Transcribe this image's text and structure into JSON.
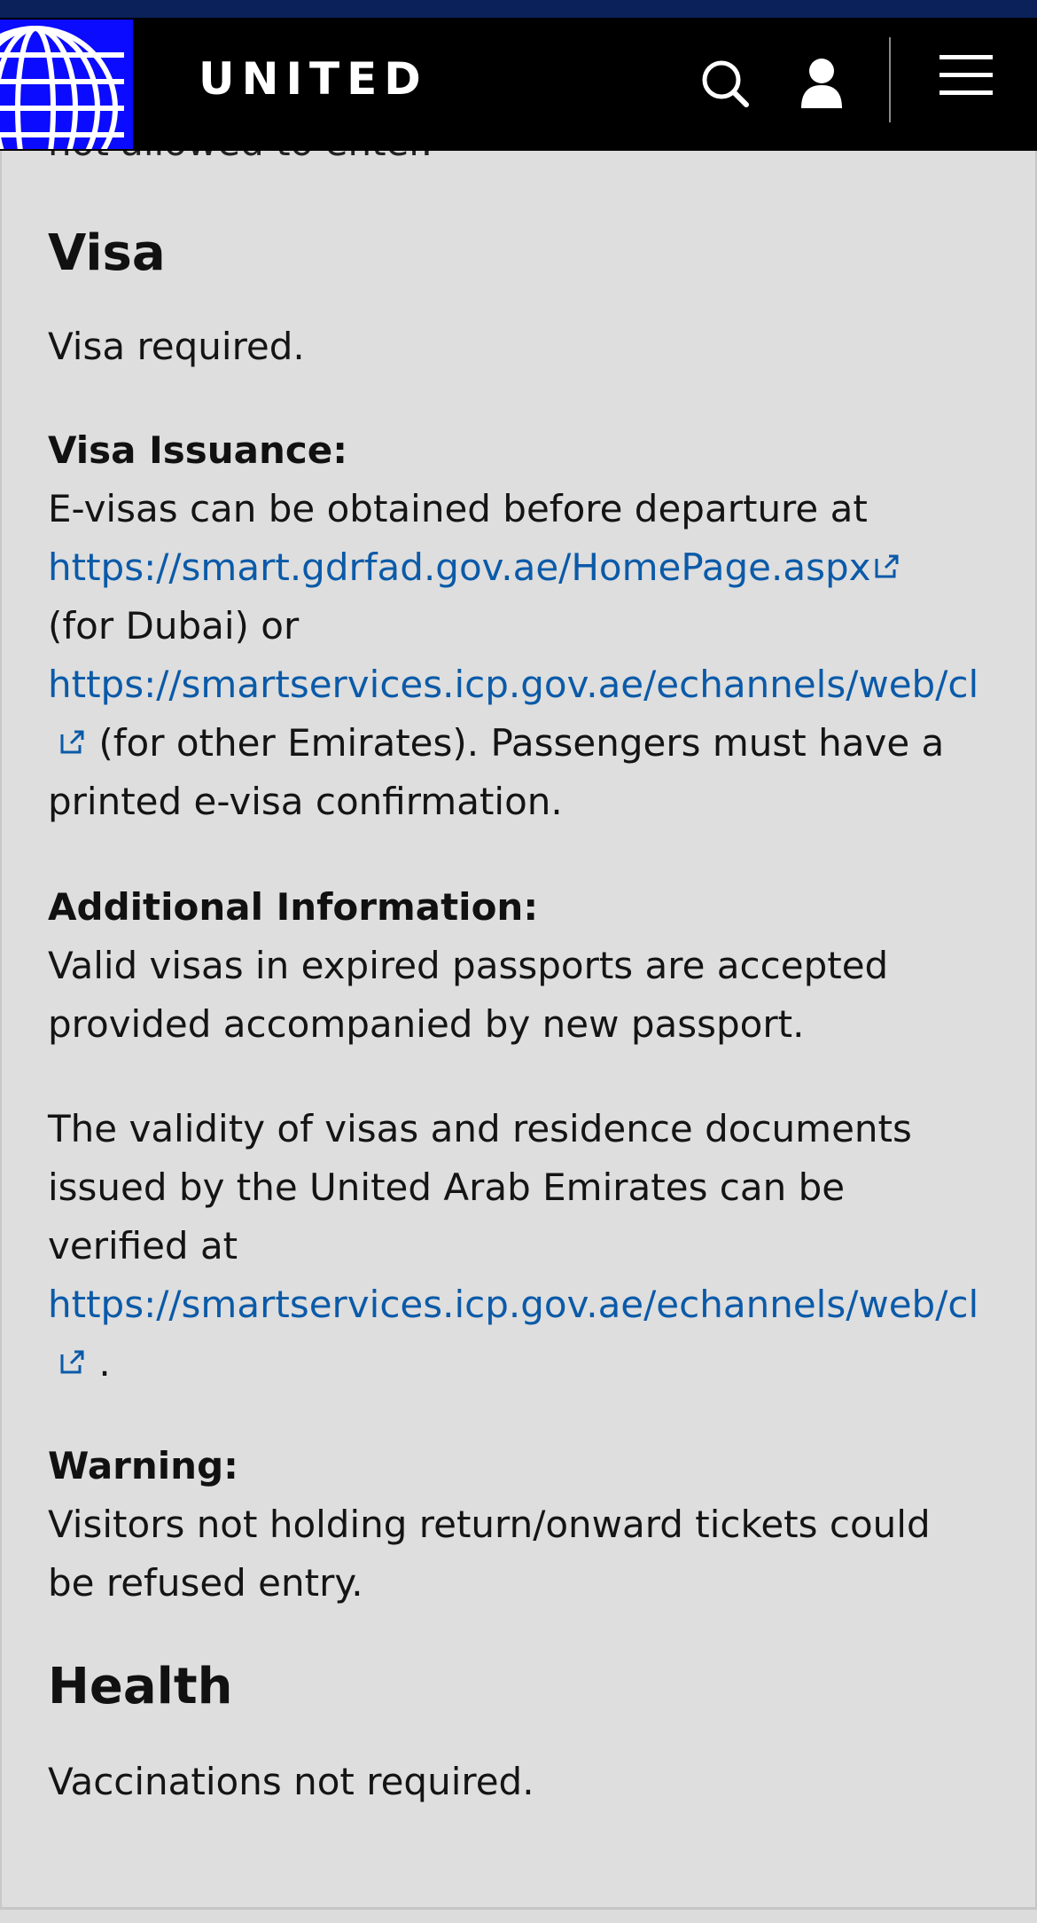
{
  "header": {
    "brand": "UNITED",
    "icons": [
      "globe-logo-icon",
      "search-icon",
      "user-icon",
      "hamburger-menu-icon"
    ]
  },
  "content": {
    "cut_text": "not allowed to enter.",
    "visa": {
      "heading": "Visa",
      "summary": "Visa required.",
      "issuance_label": "Visa Issuance:",
      "issuance_line1": "E-visas can be obtained before departure at",
      "link1": "https://smart.gdrfad.gov.ae/HomePage.aspx",
      "issuance_line2": "(for Dubai) or",
      "link2": "https://smartservices.icp.gov.ae/echannels/web/cl",
      "issuance_line3": " (for other Emirates). Passengers must have a",
      "issuance_line4": "printed e-visa confirmation.",
      "additional_label": "Additional Information:",
      "additional_line1": "Valid visas in expired passports are accepted",
      "additional_line2": "provided accompanied by new passport.",
      "validity_line1": "The validity of visas and residence documents",
      "validity_line2": "issued by the United Arab Emirates can be",
      "validity_line3": "verified at",
      "link3": "https://smartservices.icp.gov.ae/echannels/web/cl",
      "validity_end": " .",
      "warning_label": "Warning:",
      "warning_line1": "Visitors not holding return/onward tickets could",
      "warning_line2": "be refused entry."
    },
    "health": {
      "heading": "Health",
      "summary": "Vaccinations not required."
    }
  },
  "colors": {
    "header_bg": "#000000",
    "logo_bg": "#0b0bff",
    "link": "#0b5aa8",
    "content_bg": "#dedede"
  }
}
